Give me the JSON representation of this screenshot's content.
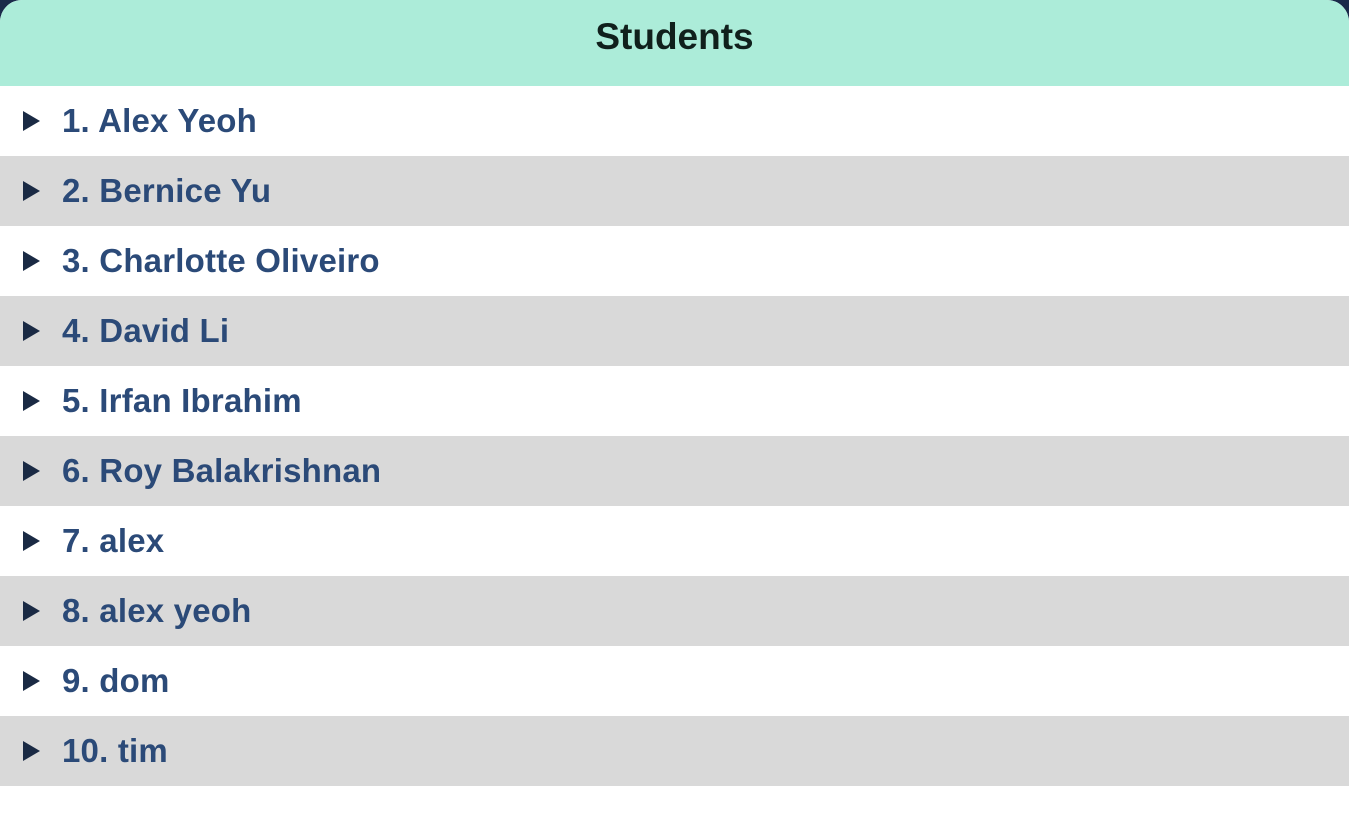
{
  "header": {
    "title": "Students"
  },
  "students": [
    {
      "label": "1. Alex Yeoh"
    },
    {
      "label": "2. Bernice Yu"
    },
    {
      "label": "3. Charlotte Oliveiro"
    },
    {
      "label": "4. David Li"
    },
    {
      "label": "5. Irfan Ibrahim"
    },
    {
      "label": "6. Roy Balakrishnan"
    },
    {
      "label": "7. alex"
    },
    {
      "label": "8. alex yeoh"
    },
    {
      "label": "9. dom"
    },
    {
      "label": "10. tim"
    }
  ],
  "colors": {
    "header_bg": "#acecd9",
    "row_alt_bg": "#d9d9d9",
    "label_text": "#2b4a78",
    "caret": "#1a2a44",
    "frame_bg": "#1a2a4a"
  },
  "icons": {
    "row_caret": "caret-right-icon"
  }
}
